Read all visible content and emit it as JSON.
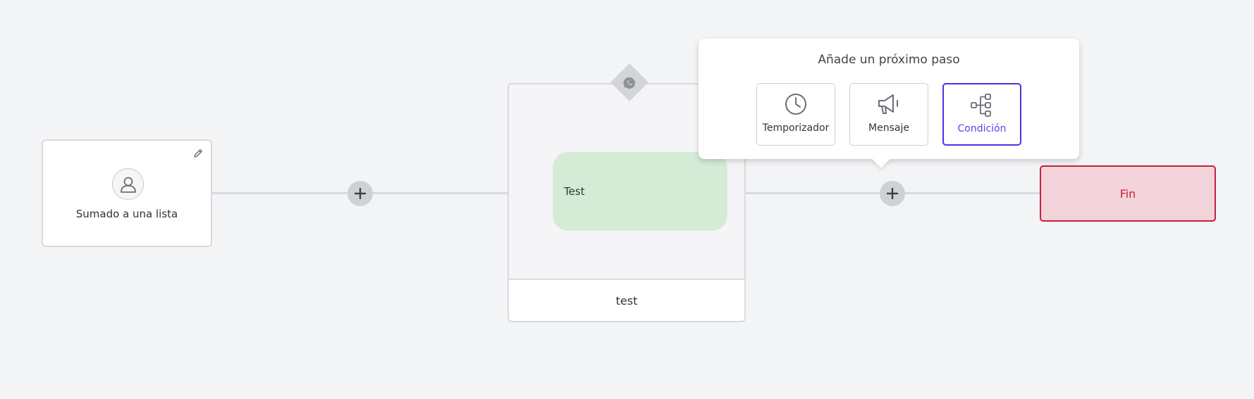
{
  "trigger": {
    "label": "Sumado a una lista",
    "icon": "user-icon",
    "edit_icon": "pencil-icon"
  },
  "message_node": {
    "channel_icon": "whatsapp-icon",
    "bubble_text": "Test",
    "footer_label": "test"
  },
  "end_node": {
    "label": "Fin",
    "border_color": "#c5213e",
    "fill_color": "#f3d3da"
  },
  "popover": {
    "title": "Añade un próximo paso",
    "options": [
      {
        "label": "Temporizador",
        "icon": "clock-icon",
        "selected": false
      },
      {
        "label": "Mensaje",
        "icon": "megaphone-icon",
        "selected": false
      },
      {
        "label": "Condición",
        "icon": "branch-icon",
        "selected": true
      }
    ],
    "accent_color": "#4b33e0"
  },
  "add_buttons": [
    {
      "icon": "plus-icon"
    },
    {
      "icon": "plus-icon"
    }
  ]
}
